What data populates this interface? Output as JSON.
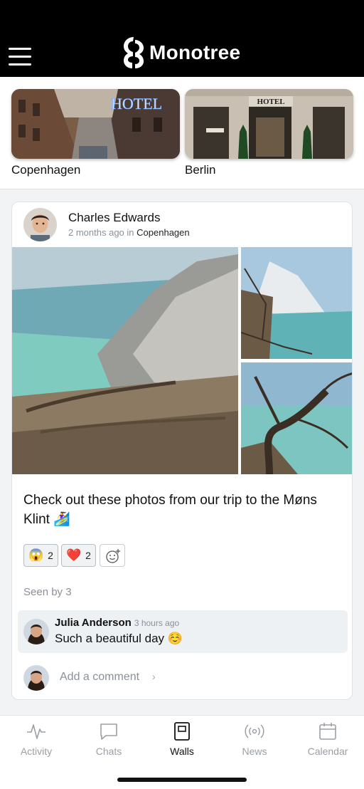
{
  "app": {
    "brand_name": "Monotree"
  },
  "walls": [
    {
      "label": "Copenhagen",
      "sign": "HOTEL"
    },
    {
      "label": "Berlin",
      "sign": "HOTEL"
    }
  ],
  "post": {
    "author": "Charles Edwards",
    "time_ago": "2 months ago",
    "in_word": "in",
    "location": "Copenhagen",
    "text": "Check out these photos from our trip to the Møns Klint 🏄‍♀️",
    "reactions": [
      {
        "emoji": "😱",
        "count": "2"
      },
      {
        "emoji": "❤️",
        "count": "2"
      }
    ],
    "seen_by": "Seen by 3",
    "comment": {
      "author": "Julia Anderson",
      "time": "3 hours ago",
      "text": "Such a beautiful day ☺️"
    },
    "add_comment_placeholder": "Add a comment",
    "chevron": "›"
  },
  "tabs": [
    {
      "label": "Activity",
      "icon": "activity-icon"
    },
    {
      "label": "Chats",
      "icon": "chat-icon"
    },
    {
      "label": "Walls",
      "icon": "walls-icon",
      "active": true
    },
    {
      "label": "News",
      "icon": "broadcast-icon"
    },
    {
      "label": "Calendar",
      "icon": "calendar-icon"
    }
  ],
  "colors": {
    "topbar": "#000000",
    "accent_text": "#111111",
    "muted_text": "#9aa0a6",
    "comment_bg": "#eef1f4"
  }
}
